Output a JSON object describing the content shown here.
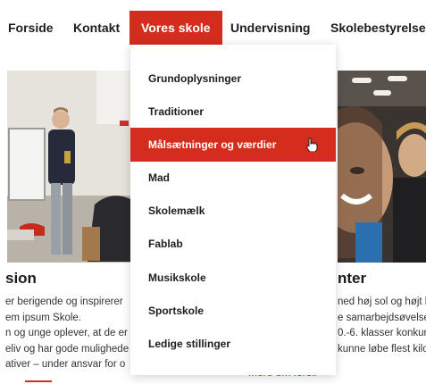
{
  "nav": {
    "items": [
      {
        "label": "Forside"
      },
      {
        "label": "Kontakt"
      },
      {
        "label": "Vores skole"
      },
      {
        "label": "Undervisning"
      },
      {
        "label": "Skolebestyrelsen"
      }
    ],
    "active": "Vores skole"
  },
  "dropdown": {
    "items": [
      {
        "label": "Grundoplysninger"
      },
      {
        "label": "Traditioner"
      },
      {
        "label": "Målsætninger og værdier"
      },
      {
        "label": "Mad"
      },
      {
        "label": "Skolemælk"
      },
      {
        "label": "Fablab"
      },
      {
        "label": "Musikskole"
      },
      {
        "label": "Sportskole"
      },
      {
        "label": "Ledige stillinger"
      }
    ],
    "hovered": "Målsætninger og værdier"
  },
  "cards": {
    "left": {
      "title": "sion",
      "lines": [
        "er berigende og inspirerer",
        "em ipsum  Skole.",
        "n og unge oplever, at de er",
        "eliv og har gode mulighede",
        "ativer – under ansvar for o"
      ]
    },
    "right": {
      "title": "nter",
      "lines": [
        "ned høj sol og højt h",
        "e samarbejdsøvelse",
        "0.-6. klasser konkur",
        "kunne løbe flest kilo"
      ],
      "more_link": "Mere om forell"
    }
  },
  "colors": {
    "accent": "#d42d1e",
    "text": "#1d1d1d",
    "background": "#ffffff"
  }
}
